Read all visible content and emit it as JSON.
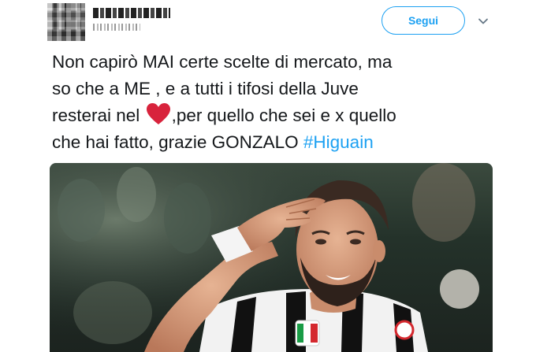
{
  "header": {
    "follow_label": "Segui",
    "icons": {
      "menu": "chevron-down-icon"
    }
  },
  "tweet": {
    "lines": [
      "Non capirò MAI certe scelte di mercato, ma",
      "so che a ME , e a tutti i tifosi della Juve",
      "resterai nel",
      ",per quello che sei e x quello",
      "che hai fatto,  grazie GONZALO ",
      "#Higuain"
    ],
    "emoji": "heart"
  },
  "colors": {
    "accent": "#1da1f2",
    "text": "#14171a",
    "heart": "#e0245e"
  }
}
